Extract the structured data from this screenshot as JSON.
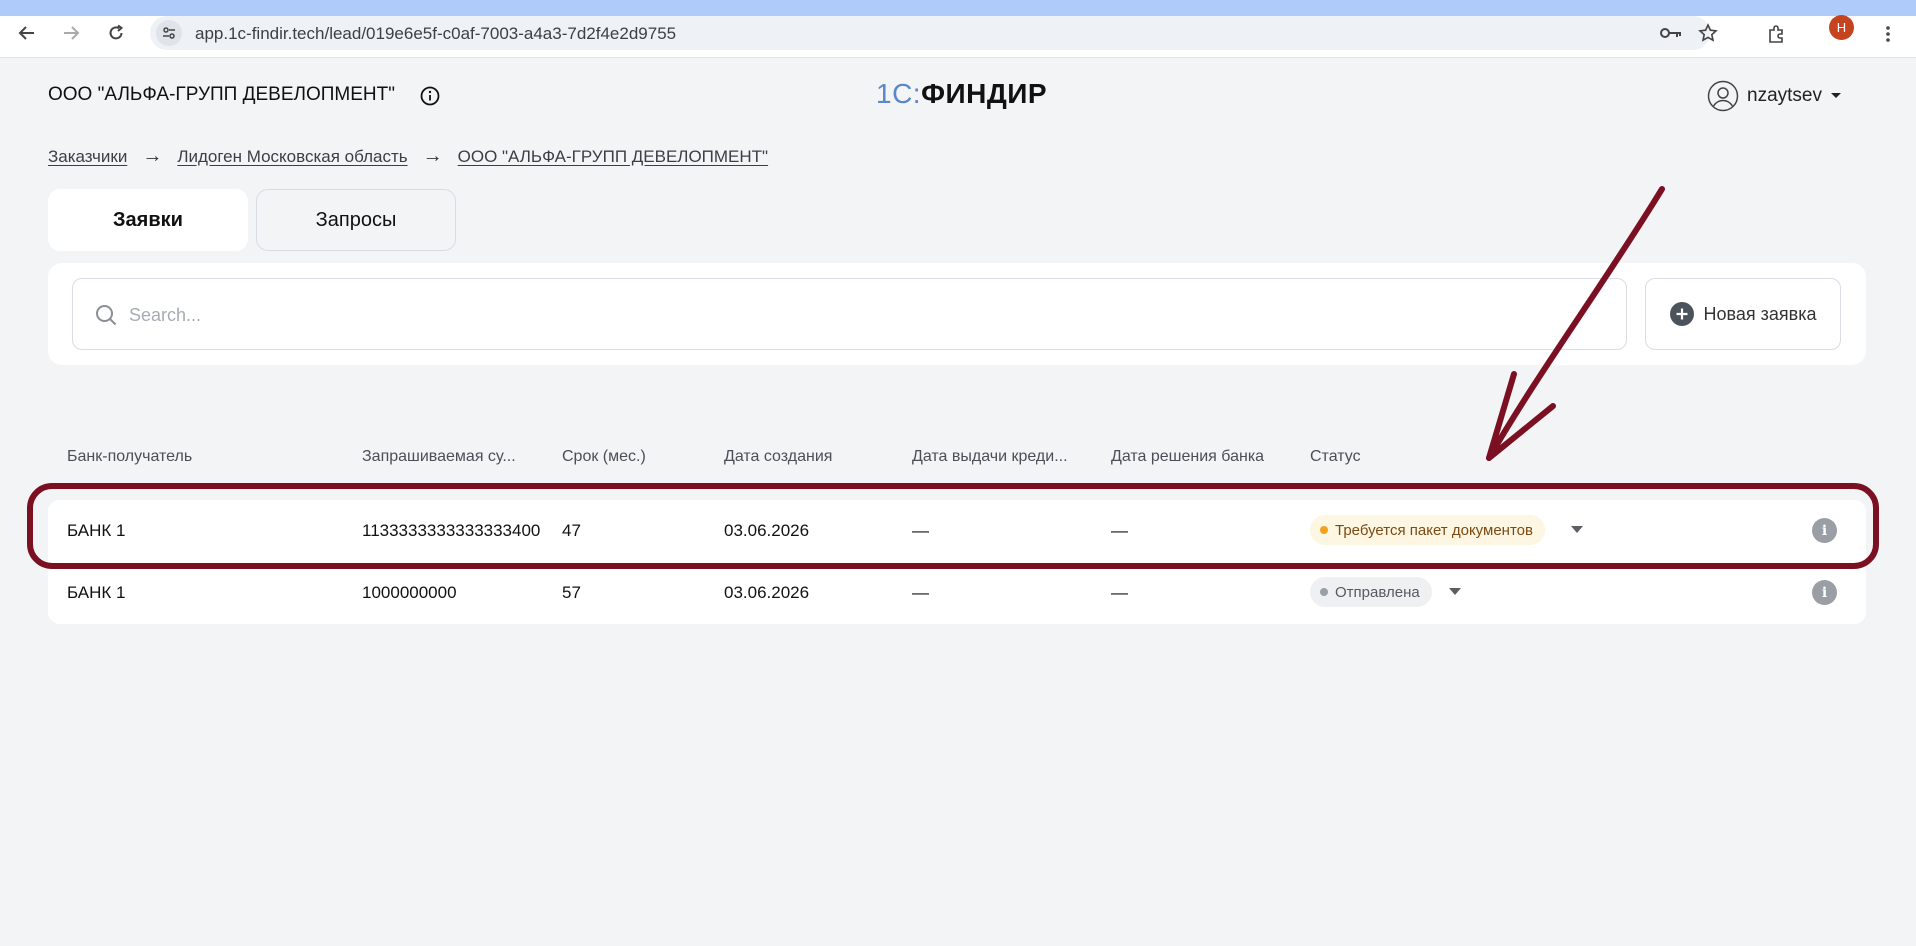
{
  "browser": {
    "url": "app.1c-findir.tech/lead/019e6e5f-c0af-7003-a4a3-7d2f4e2d9755",
    "profile_initial": "Н"
  },
  "header": {
    "company": "ООО \"АЛЬФА-ГРУПП ДЕВЕЛОПМЕНТ\"",
    "logo_prefix": "1С:",
    "logo_name": "ФИНДИР",
    "username": "nzaytsev"
  },
  "breadcrumb": [
    {
      "label": "Заказчики"
    },
    {
      "label": "Лидоген Московская область"
    },
    {
      "label": "ООО \"АЛЬФА-ГРУПП ДЕВЕЛОПМЕНТ\""
    }
  ],
  "breadcrumb_sep": "→",
  "tabs": [
    {
      "label": "Заявки",
      "active": true
    },
    {
      "label": "Запросы",
      "active": false
    }
  ],
  "search": {
    "placeholder": "Search..."
  },
  "new_request_label": "Новая заявка",
  "table": {
    "columns": [
      "Банк-получатель",
      "Запрашиваемая су...",
      "Срок (мес.)",
      "Дата создания",
      "Дата выдачи креди...",
      "Дата решения банка",
      "Статус"
    ],
    "rows": [
      {
        "bank": "БАНК 1",
        "amount": "1133333333333333400",
        "term": "47",
        "created": "03.06.2026",
        "issued": "—",
        "decision": "—",
        "status": "Требуется пакет документов",
        "status_color": "#f2a11a"
      },
      {
        "bank": "БАНК 1",
        "amount": "1000000000",
        "term": "57",
        "created": "03.06.2026",
        "issued": "—",
        "decision": "—",
        "status": "Отправлена",
        "status_color": "#9aa0a8"
      }
    ]
  },
  "colors": {
    "annotation": "#7a1022",
    "logo_accent": "#5b86c9",
    "page_bg": "#f3f4f6"
  }
}
